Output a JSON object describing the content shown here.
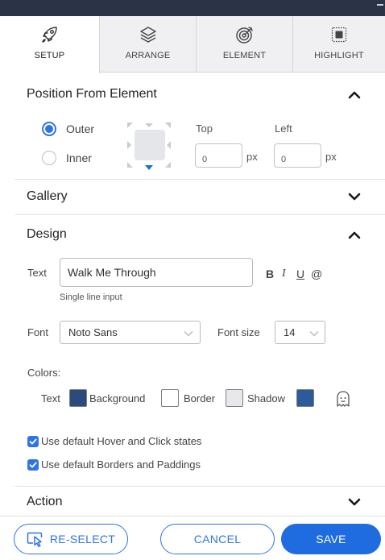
{
  "tabs": [
    {
      "label": "SETUP",
      "icon": "rocket-icon",
      "active": true
    },
    {
      "label": "ARRANGE",
      "icon": "layers-icon",
      "active": false
    },
    {
      "label": "ELEMENT",
      "icon": "target-icon",
      "active": false
    },
    {
      "label": "HIGHLIGHT",
      "icon": "highlight-frame-icon",
      "active": false
    }
  ],
  "position": {
    "title": "Position From Element",
    "options": [
      {
        "label": "Outer",
        "checked": true
      },
      {
        "label": "Inner",
        "checked": false
      }
    ],
    "top_label": "Top",
    "left_label": "Left",
    "top_value": "0",
    "left_value": "0",
    "unit": "px"
  },
  "gallery": {
    "title": "Gallery"
  },
  "design": {
    "title": "Design",
    "text_label": "Text",
    "text_value": "Walk Me Through",
    "hint": "Single line input",
    "format": {
      "bold": "B",
      "italic": "I",
      "underline": "U",
      "mention": "@"
    },
    "font_label": "Font",
    "font_value": "Noto Sans",
    "font_size_label": "Font size",
    "font_size_value": "14",
    "colors_label": "Colors:",
    "colors": [
      {
        "label": "Text",
        "color": "#2d4a7f"
      },
      {
        "label": "Background",
        "color": "#ffffff"
      },
      {
        "label": "Border",
        "color": "#e8e8ea"
      },
      {
        "label": "Shadow",
        "color": "#2d5a98"
      }
    ],
    "checkboxes": [
      {
        "label": "Use default Hover and Click states",
        "checked": true
      },
      {
        "label": "Use default Borders and Paddings",
        "checked": true
      }
    ]
  },
  "action": {
    "title": "Action"
  },
  "footer": {
    "reselect_label": "RE-SELECT",
    "cancel_label": "CANCEL",
    "save_label": "SAVE"
  },
  "colors": {
    "accent": "#2f74e6",
    "primary_button": "#1f6be0",
    "topbar": "#2b3447",
    "tab_bg": "#f0f0f2"
  }
}
